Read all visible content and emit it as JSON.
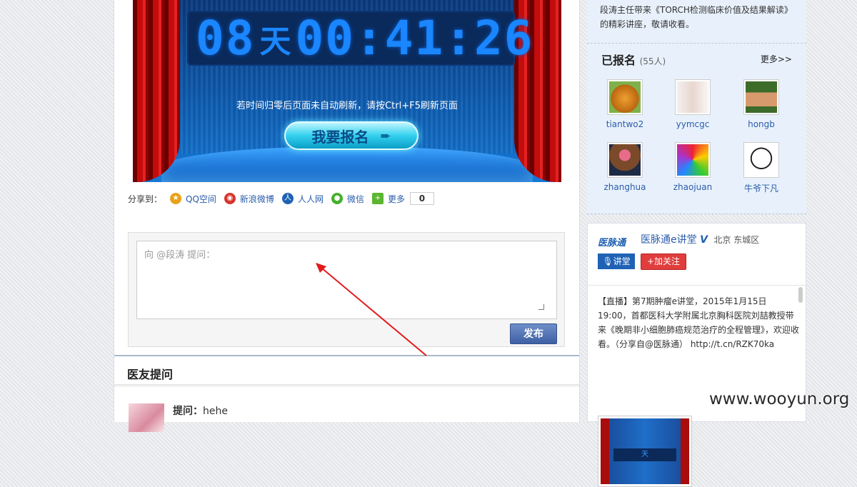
{
  "countdown": {
    "days": "08",
    "days_unit": "天",
    "hours": "00",
    "minutes": "41",
    "seconds": "26",
    "sep": ":"
  },
  "stage": {
    "notice": "若时间归零后页面未自动刷新，请按Ctrl+F5刷新页面",
    "signup_label": "我要报名"
  },
  "share": {
    "label": "分享到：",
    "items": [
      {
        "label": "QQ空间",
        "icon": "qzone-icon",
        "color": "#e8a21a"
      },
      {
        "label": "新浪微博",
        "icon": "weibo-icon",
        "color": "#d6352c"
      },
      {
        "label": "人人网",
        "icon": "renren-icon",
        "color": "#1f62b5"
      },
      {
        "label": "微信",
        "icon": "wechat-icon",
        "color": "#43b02a"
      },
      {
        "label": "更多",
        "icon": "plus-icon",
        "color": "#5cb531"
      }
    ],
    "count": "0"
  },
  "ask": {
    "placeholder": "向 @段涛 提问：",
    "submit_label": "发布"
  },
  "questions": {
    "heading": "医友提问",
    "first": {
      "label": "提问：",
      "text": "hehe"
    }
  },
  "sidebar": {
    "intro": "段涛主任带来《TORCH检测临床价值及结果解读》的精彩讲座，敬请收看。",
    "registered": {
      "title": "已报名",
      "count": "(55人)",
      "more": "更多>>",
      "users": [
        {
          "name": "tiantwo2",
          "icon": "cat-avatar"
        },
        {
          "name": "yymcgc",
          "icon": "girl-avatar"
        },
        {
          "name": "hongb",
          "icon": "pixel-soldier-avatar"
        },
        {
          "name": "zhanghua",
          "icon": "cake-avatar"
        },
        {
          "name": "zhaojuan",
          "icon": "pinwheel-avatar"
        },
        {
          "name": "牛爷下凡",
          "icon": "cow-avatar"
        }
      ]
    }
  },
  "publisher": {
    "logo_text": "医脉通",
    "logo_tag": "讲堂",
    "name": "医脉通e讲堂",
    "verified": "V",
    "location": "北京 东城区",
    "follow_label": "+加关注",
    "post": "【直播】第7期肿瘤e讲堂，2015年1月15日19:00，首都医科大学附属北京胸科医院刘喆教授带来《晚期非小细胞肺癌规范治疗的全程管理》，欢迎收看。（分享自@医脉通） http://t.cn/RZK70ka",
    "thumb_caption": "天"
  },
  "watermark": "www.wooyun.org",
  "annotation": {
    "arrow_color": "#e21b1b"
  }
}
